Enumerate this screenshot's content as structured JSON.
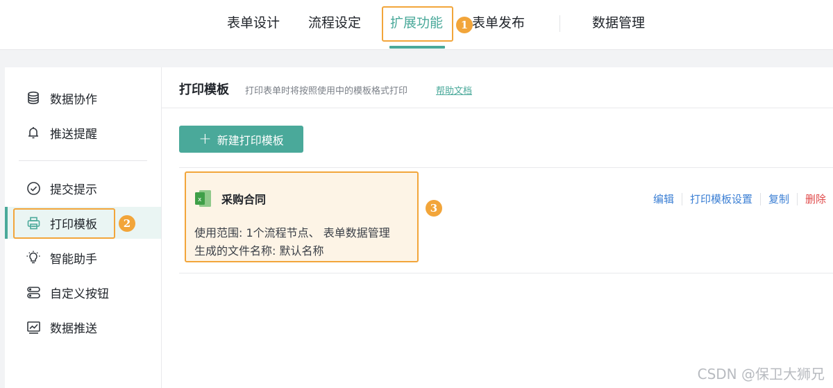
{
  "top_nav": {
    "tabs": [
      {
        "label": "表单设计"
      },
      {
        "label": "流程设定"
      },
      {
        "label": "扩展功能"
      },
      {
        "label": "表单发布"
      },
      {
        "label": "数据管理"
      }
    ],
    "active_tab": "扩展功能"
  },
  "annotations": {
    "step1": "1",
    "step2": "2",
    "step3": "3"
  },
  "sidebar": {
    "items": [
      {
        "label": "数据协作",
        "icon": "database-icon"
      },
      {
        "label": "推送提醒",
        "icon": "bell-icon"
      },
      {
        "label": "提交提示",
        "icon": "check-circle-icon"
      },
      {
        "label": "打印模板",
        "icon": "printer-icon"
      },
      {
        "label": "智能助手",
        "icon": "lightbulb-icon"
      },
      {
        "label": "自定义按钮",
        "icon": "button-toggle-icon"
      },
      {
        "label": "数据推送",
        "icon": "line-chart-icon"
      }
    ],
    "active_item": "打印模板"
  },
  "main": {
    "title": "打印模板",
    "description": "打印表单时将按照使用中的模板格式打印",
    "help_link": "帮助文档",
    "new_button_label": "新建打印模板",
    "template": {
      "name": "采购合同",
      "icon": "excel-file-icon",
      "usage_line": "使用范围: 1个流程节点、 表单数据管理",
      "filename_line": "生成的文件名称: 默认名称",
      "actions": [
        "编辑",
        "打印模板设置",
        "复制",
        "删除"
      ]
    }
  },
  "watermark": "CSDN @保卫大狮兄",
  "colors": {
    "accent": "#4aa99a",
    "highlight": "#f2a53a",
    "link": "#3b7fd4",
    "danger": "#e04a4a",
    "card_bg": "#fdf4e6"
  }
}
